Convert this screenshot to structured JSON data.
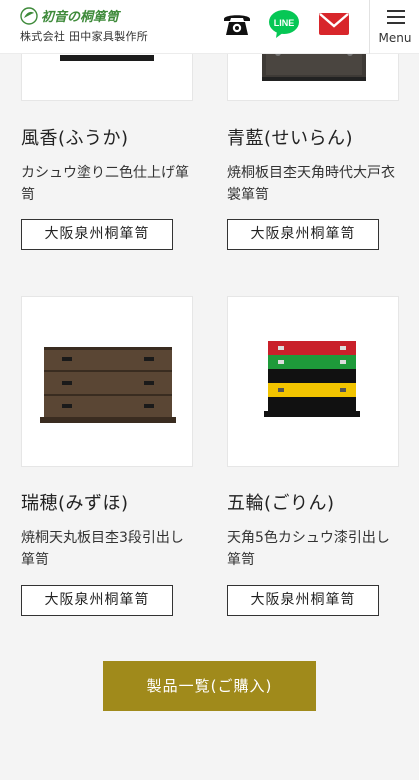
{
  "header": {
    "logo_title": "初音の桐箪笥",
    "company": "株式会社 田中家具製作所",
    "phone_icon": "phone-icon",
    "line_label": "LINE",
    "mail_icon": "mail-icon",
    "menu_label": "Menu"
  },
  "colors": {
    "brand_green": "#3e8a3a",
    "line_green": "#06c755",
    "mail_red": "#d8262b",
    "cta_gold": "#a08a1b"
  },
  "products": [
    {
      "name": "風香(ふうか)",
      "desc": "カシュウ塗り二色仕上げ箪笥",
      "tag": "大阪泉州桐箪笥"
    },
    {
      "name": "青藍(せいらん)",
      "desc": "焼桐板目杢天角時代大戸衣裳箪笥",
      "tag": "大阪泉州桐箪笥"
    },
    {
      "name": "瑞穂(みずほ)",
      "desc": "焼桐天丸板目杢3段引出し箪笥",
      "tag": "大阪泉州桐箪笥"
    },
    {
      "name": "五輪(ごりん)",
      "desc": "天角5色カシュウ漆引出し箪笥",
      "tag": "大阪泉州桐箪笥"
    }
  ],
  "cta_label": "製品一覧(ご購入)"
}
